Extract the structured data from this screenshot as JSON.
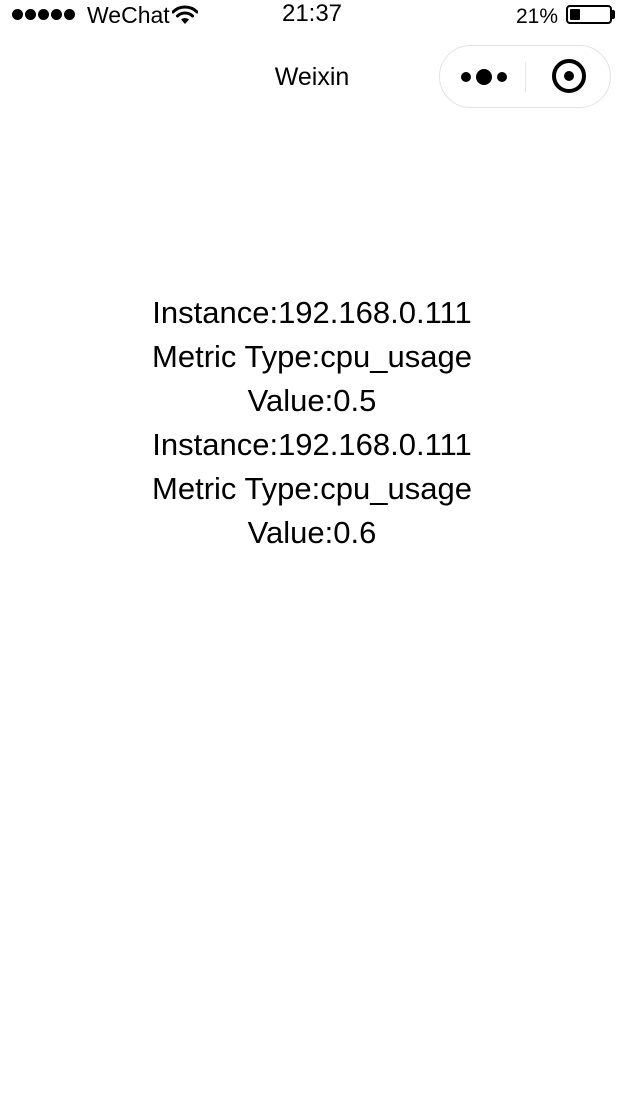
{
  "status_bar": {
    "carrier": "WeChat",
    "time": "21:37",
    "battery_percent": "21%",
    "battery_level": 0.21,
    "signal_bars": 5,
    "icons": [
      "signal-dots-icon",
      "wifi-icon",
      "battery-icon"
    ]
  },
  "nav": {
    "title": "Weixin",
    "icons": [
      "more-dots-icon",
      "close-target-icon"
    ]
  },
  "records": [
    {
      "instance_line": "Instance:192.168.0.111",
      "metric_line": "Metric Type:cpu_usage",
      "value_line": "Value:0.5"
    },
    {
      "instance_line": "Instance:192.168.0.111",
      "metric_line": "Metric Type:cpu_usage",
      "value_line": "Value:0.6"
    }
  ]
}
